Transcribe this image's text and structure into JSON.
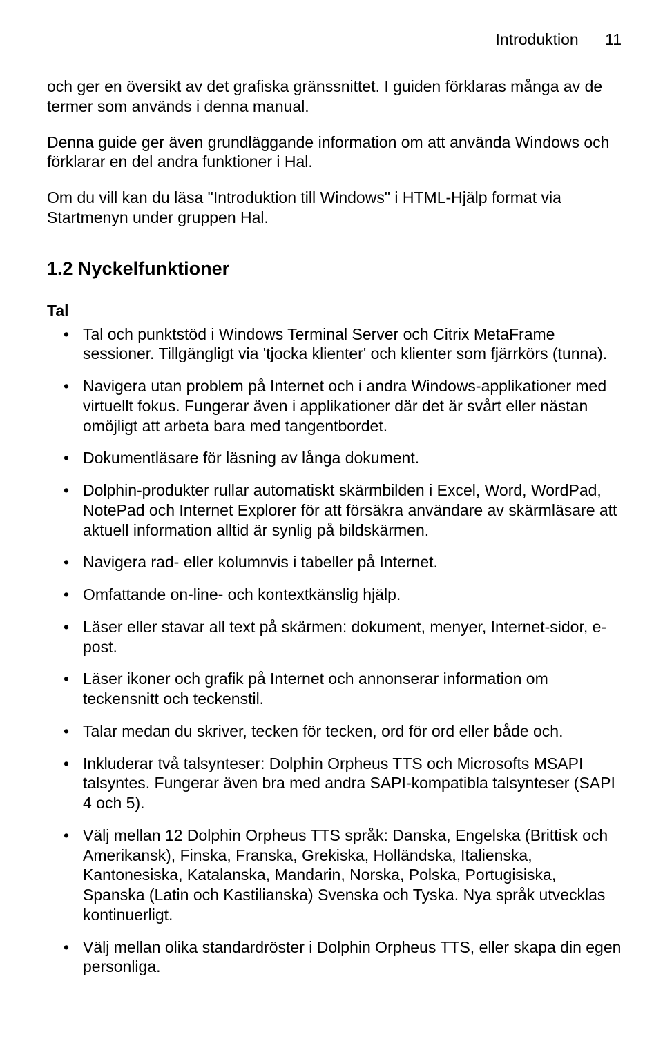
{
  "header": {
    "section": "Introduktion",
    "page_number": "11"
  },
  "body": {
    "p1": "och ger en översikt av det grafiska gränssnittet. I guiden förklaras många av de termer som används i denna manual.",
    "p2": "Denna guide ger även grundläggande information om att använda Windows och förklarar en del andra funktioner i Hal.",
    "p3": "Om du vill kan du läsa \"Introduktion till Windows\" i HTML-Hjälp format via Startmenyn under gruppen Hal."
  },
  "section": {
    "heading": "1.2  Nyckelfunktioner",
    "subsection": "Tal",
    "items": [
      "Tal och punktstöd i Windows Terminal Server och Citrix MetaFrame sessioner. Tillgängligt via 'tjocka klienter' och klienter som fjärrkörs (tunna).",
      "Navigera utan problem på Internet och i andra Windows-applikationer med virtuellt fokus. Fungerar även i applikationer där det är svårt eller nästan omöjligt att arbeta bara med tangentbordet.",
      "Dokumentläsare för läsning av långa dokument.",
      "Dolphin-produkter rullar automatiskt skärmbilden i Excel, Word, WordPad, NotePad och Internet Explorer för att försäkra användare av skärmläsare att aktuell information alltid är synlig på bildskärmen.",
      "Navigera rad- eller kolumnvis i tabeller på Internet.",
      "Omfattande on-line- och kontextkänslig hjälp.",
      "Läser eller stavar all text på skärmen: dokument, menyer, Internet-sidor, e-post.",
      "Läser ikoner och grafik på Internet och annonserar information om teckensnitt och teckenstil.",
      "Talar medan du skriver, tecken för tecken, ord för ord eller både och.",
      "Inkluderar två talsynteser: Dolphin Orpheus TTS och Microsofts MSAPI talsyntes. Fungerar även bra med andra SAPI-kompatibla talsynteser (SAPI 4 och 5).",
      "Välj mellan 12 Dolphin Orpheus TTS språk: Danska, Engelska (Brittisk och Amerikansk), Finska, Franska, Grekiska, Holländska, Italienska, Kantonesiska, Katalanska, Mandarin, Norska, Polska, Portugisiska, Spanska (Latin och Kastilianska) Svenska och Tyska. Nya språk utvecklas kontinuerligt.",
      "Välj mellan olika standardröster i Dolphin Orpheus TTS, eller skapa din egen personliga."
    ]
  }
}
